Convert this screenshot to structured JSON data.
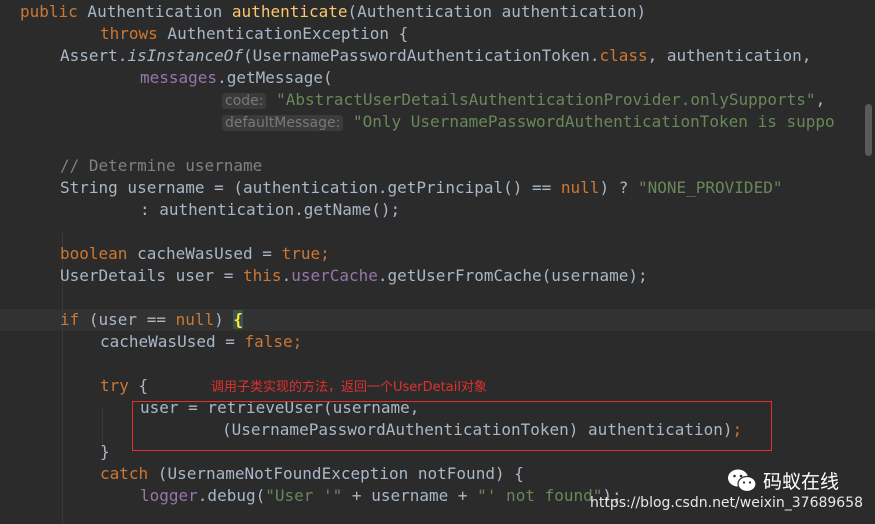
{
  "code": {
    "line01": {
      "kw_public": "public",
      "type_auth": " Authentication ",
      "method_name": "authenticate",
      "params": "(Authentication authentication)"
    },
    "line02": {
      "kw_throws": "throws",
      "exception": " AuthenticationException {"
    },
    "line03": {
      "assert_prefix": "Assert.",
      "assert_method": "isInstanceOf",
      "arg_open": "(UsernamePasswordAuthenticationToken.",
      "kw_class": "class",
      "arg_rest": ", authentication,"
    },
    "line04": {
      "field_messages": "messages",
      "call_get_message": ".getMessage("
    },
    "line05": {
      "hint_code": "code:",
      "str_code": "\"AbstractUserDetailsAuthenticationProvider.onlySupports\"",
      "comma": ","
    },
    "line06": {
      "hint_default": "defaultMessage:",
      "str_default": "\"Only UsernamePasswordAuthenticationToken is suppo"
    },
    "line08": {
      "comment": "// Determine username"
    },
    "line09": {
      "decl": "String username = (authentication.getPrincipal() == ",
      "kw_null": "null",
      "ternary": ") ? ",
      "str_none": "\"NONE_PROVIDED\""
    },
    "line10": {
      "text": ": authentication.getName();"
    },
    "line12": {
      "kw_boolean": "boolean",
      "decl": " cacheWasUsed = ",
      "kw_true": "true",
      "semi": ";"
    },
    "line13": {
      "decl": "UserDetails user = ",
      "kw_this": "this",
      "dot": ".",
      "field_cache": "userCache",
      "call": ".getUserFromCache(username);"
    },
    "line15": {
      "kw_if": "if",
      "cond_open": " (user == ",
      "kw_null": "null",
      "cond_close": ") ",
      "brace": "{"
    },
    "line16": {
      "assign": "cacheWasUsed = ",
      "kw_false": "false",
      "semi": ";"
    },
    "line18": {
      "kw_try": "try",
      "brace": " {"
    },
    "line19": {
      "text": "user = retrieveUser(username,"
    },
    "line20": {
      "text": "(UsernamePasswordAuthenticationToken) authentication)",
      "semi": ";"
    },
    "line21": {
      "text": "}"
    },
    "line22": {
      "kw_catch": "catch",
      "text": " (UsernameNotFoundException notFound) {"
    },
    "line23": {
      "field_logger": "logger",
      "call": ".debug(",
      "str_user": "\"User '\"",
      "concat": " + username + ",
      "str_not_found": "\"' not found\"",
      "close": ");"
    }
  },
  "annotation": {
    "text": "调用子类实现的方法，返回一个UserDetail对象",
    "color": "#e0302f"
  },
  "watermark": {
    "brand": "码蚁在线",
    "url": "https://blog.csdn.net/weixin_37689658"
  },
  "theme": {
    "background": "#2b2b2b",
    "keyword": "#cc7832",
    "method": "#ffc66d",
    "field": "#9876aa",
    "string": "#6a8759",
    "comment": "#808080",
    "text": "#a9b7c6"
  }
}
